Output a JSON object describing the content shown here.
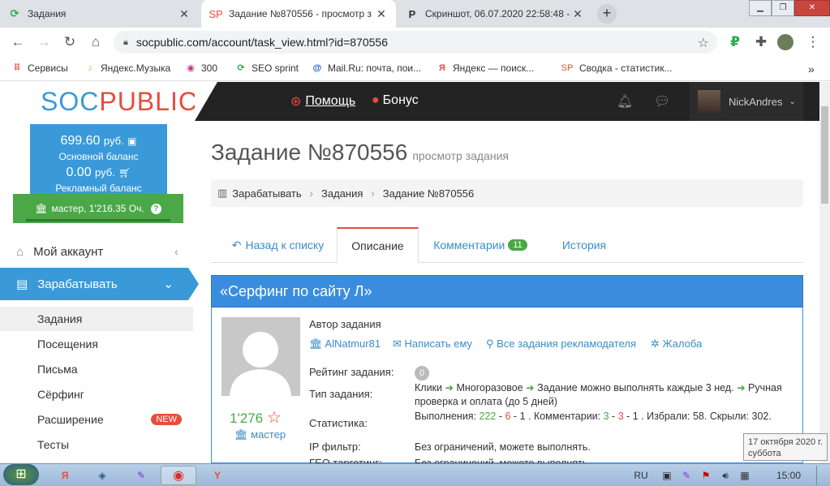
{
  "browser": {
    "tabs": [
      {
        "icon": "seo-sprint-icon",
        "title": "Задания",
        "active": false
      },
      {
        "icon": "socpublic-icon",
        "title": "Задание №870556 - просмотр з",
        "active": true
      },
      {
        "icon": "pics-icon",
        "title": "Скриншот, 06.07.2020 22:58:48 -",
        "active": false
      }
    ],
    "url": "socpublic.com/account/task_view.html?id=870556",
    "bookmarks": [
      {
        "icon": "apps-icon",
        "label": "Сервисы"
      },
      {
        "icon": "yandex-music-icon",
        "label": "Яндекс.Музыка"
      },
      {
        "icon": "instagram-icon",
        "label": "300"
      },
      {
        "icon": "seo-sprint-icon",
        "label": "SEO sprint"
      },
      {
        "icon": "mailru-icon",
        "label": "Mail.Ru: почта, пои..."
      },
      {
        "icon": "yandex-icon",
        "label": "Яндекс — поиск..."
      },
      {
        "icon": "socpublic-icon",
        "label": "Сводка - статистик..."
      }
    ],
    "bookmarks_more": "»"
  },
  "site": {
    "logo_a": "SOC",
    "logo_b": "PUBLIC",
    "help": "Помощь",
    "bonus": "Бонус",
    "username": "NickAndres"
  },
  "sidebar": {
    "main_balance": "699.60",
    "currency": "руб.",
    "main_balance_label": "Основной баланс",
    "ad_balance": "0.00",
    "ad_balance_label": "Рекламный баланс",
    "rank": "мастер, 1'216.35 Оч.",
    "menu": [
      {
        "label": "Мой аккаунт",
        "icon": "home-icon"
      },
      {
        "label": "Зарабатывать",
        "icon": "briefcase-icon"
      }
    ],
    "submenu": [
      "Задания",
      "Посещения",
      "Письма",
      "Сёрфинг",
      "Расширение",
      "Тесты"
    ],
    "new_badge": "NEW"
  },
  "page": {
    "title": "Задание №870556",
    "subtitle": "просмотр задания",
    "breadcrumbs": [
      "Зарабатывать",
      "Задания",
      "Задание №870556"
    ],
    "tabs": [
      "Назад к списку",
      "Описание",
      "Комментарии",
      "История"
    ],
    "comments_count": "11",
    "task_title": "«Серфинг по сайту Л»",
    "author_label": "Автор задания",
    "author": "AlNatmur81",
    "write": "Написать ему",
    "all_tasks": "Все задания рекламодателя",
    "complaint": "Жалоба",
    "author_rating": "1'276",
    "author_rank": "мастер",
    "rating_label": "Рейтинг задания:",
    "rating_value": "0",
    "type_label": "Тип задания:",
    "type_parts": [
      "Клики",
      "Многоразовое",
      "Задание можно выполнять каждые 3 нед.",
      "Ручная проверка и оплата (до 5 дней)"
    ],
    "stats_label": "Статистика:",
    "stats": {
      "done_label": "Выполнения:",
      "done_total": "222",
      "done_red": "6",
      "done_other": "1",
      "comments_label": "Комментарии:",
      "c1": "3",
      "c2": "3",
      "c3": "1",
      "rest": "Избрали: 58. Скрыли:",
      "rest2": "302."
    },
    "ip_label": "IP фильтр:",
    "ip_value": "Без ограничений, можете выполнять.",
    "geo_label": "ГЕО таргетинг:",
    "geo_value": "Без ограничений, можете выполнять."
  },
  "tooltip": {
    "line1": "17 октября 2020 г.",
    "line2": "суббота"
  },
  "taskbar": {
    "lang": "RU",
    "time": "15:00"
  }
}
